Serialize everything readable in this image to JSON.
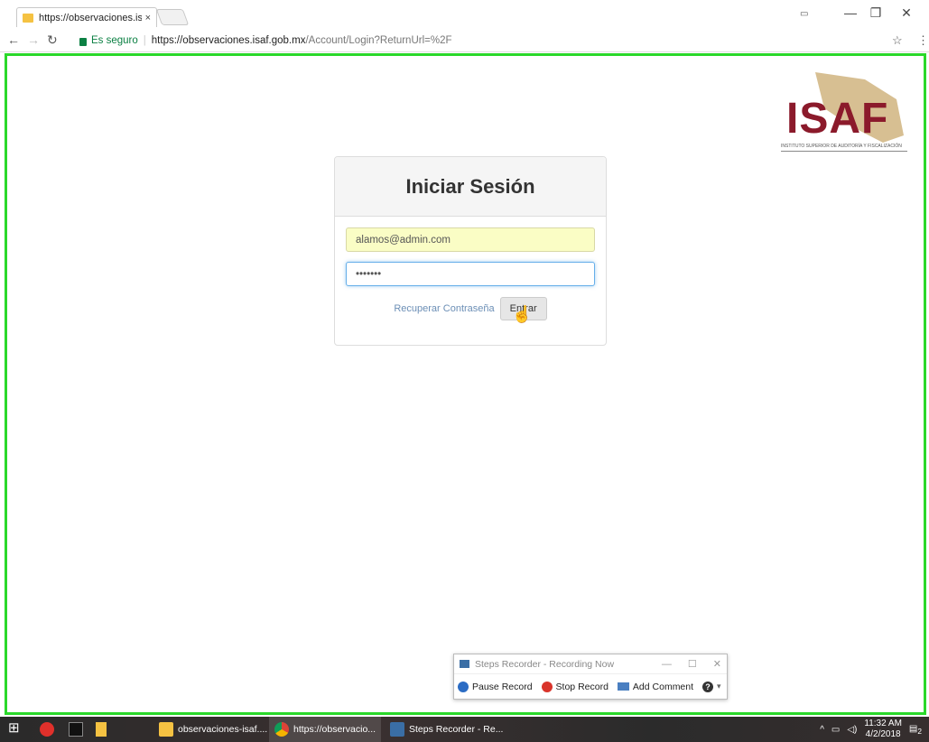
{
  "browser": {
    "tab_title": "https://observaciones.isa",
    "tab_close": "×",
    "profile_label": "ﾠ",
    "address": {
      "secure_label": "Es seguro",
      "url_host": "https://observaciones.isaf.gob.mx",
      "url_path": "/Account/Login?ReturnUrl=%2F"
    },
    "window_controls": [
      "—",
      "❐",
      "✕"
    ]
  },
  "page": {
    "logo_text": "ISAF",
    "logo_subtitle": "INSTITUTO SUPERIOR DE AUDITORÍA Y FISCALIZACIÓN",
    "login": {
      "title": "Iniciar Sesión",
      "email_value": "alamos@admin.com",
      "password_value": "•••••••",
      "recover_label": "Recuperar Contraseña",
      "submit_label": "Entrar"
    }
  },
  "steps_recorder": {
    "title": "Steps Recorder - Recording Now",
    "pause_label": "Pause Record",
    "stop_label": "Stop Record",
    "comment_label": "Add Comment",
    "help_label": "?"
  },
  "taskbar": {
    "tasks": [
      {
        "label": "observaciones-isaf...."
      },
      {
        "label": "https://observacio..."
      },
      {
        "label": "Steps Recorder - Re..."
      }
    ],
    "clock_time": "11:32 AM",
    "clock_date": "4/2/2018",
    "notification_count": "2"
  },
  "colors": {
    "viewport_border": "#2ad82a",
    "logo": "#8b1a2b",
    "link": "#6c8fb6",
    "secure": "#0b8043"
  }
}
